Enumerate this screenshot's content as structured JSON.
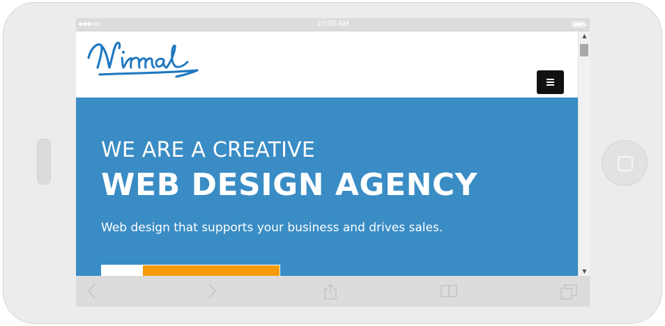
{
  "status_bar": {
    "time": "10:03 AM"
  },
  "site": {
    "logo_text": "Nirmal",
    "menu_icon": "hamburger-icon",
    "hero": {
      "kicker": "WE ARE A CREATIVE",
      "title": "WEB DESIGN AGENCY",
      "subtitle": "Web design that supports your business and drives sales."
    }
  },
  "browser_toolbar": {
    "icons": [
      "back-arrow-icon",
      "forward-arrow-icon",
      "share-icon",
      "bookmarks-icon",
      "tabs-icon"
    ]
  },
  "colors": {
    "hero_background": "#3a8cc5",
    "cta_orange": "#f79a09",
    "logo_blue": "#1f78c1",
    "menu_button": "#111111"
  }
}
